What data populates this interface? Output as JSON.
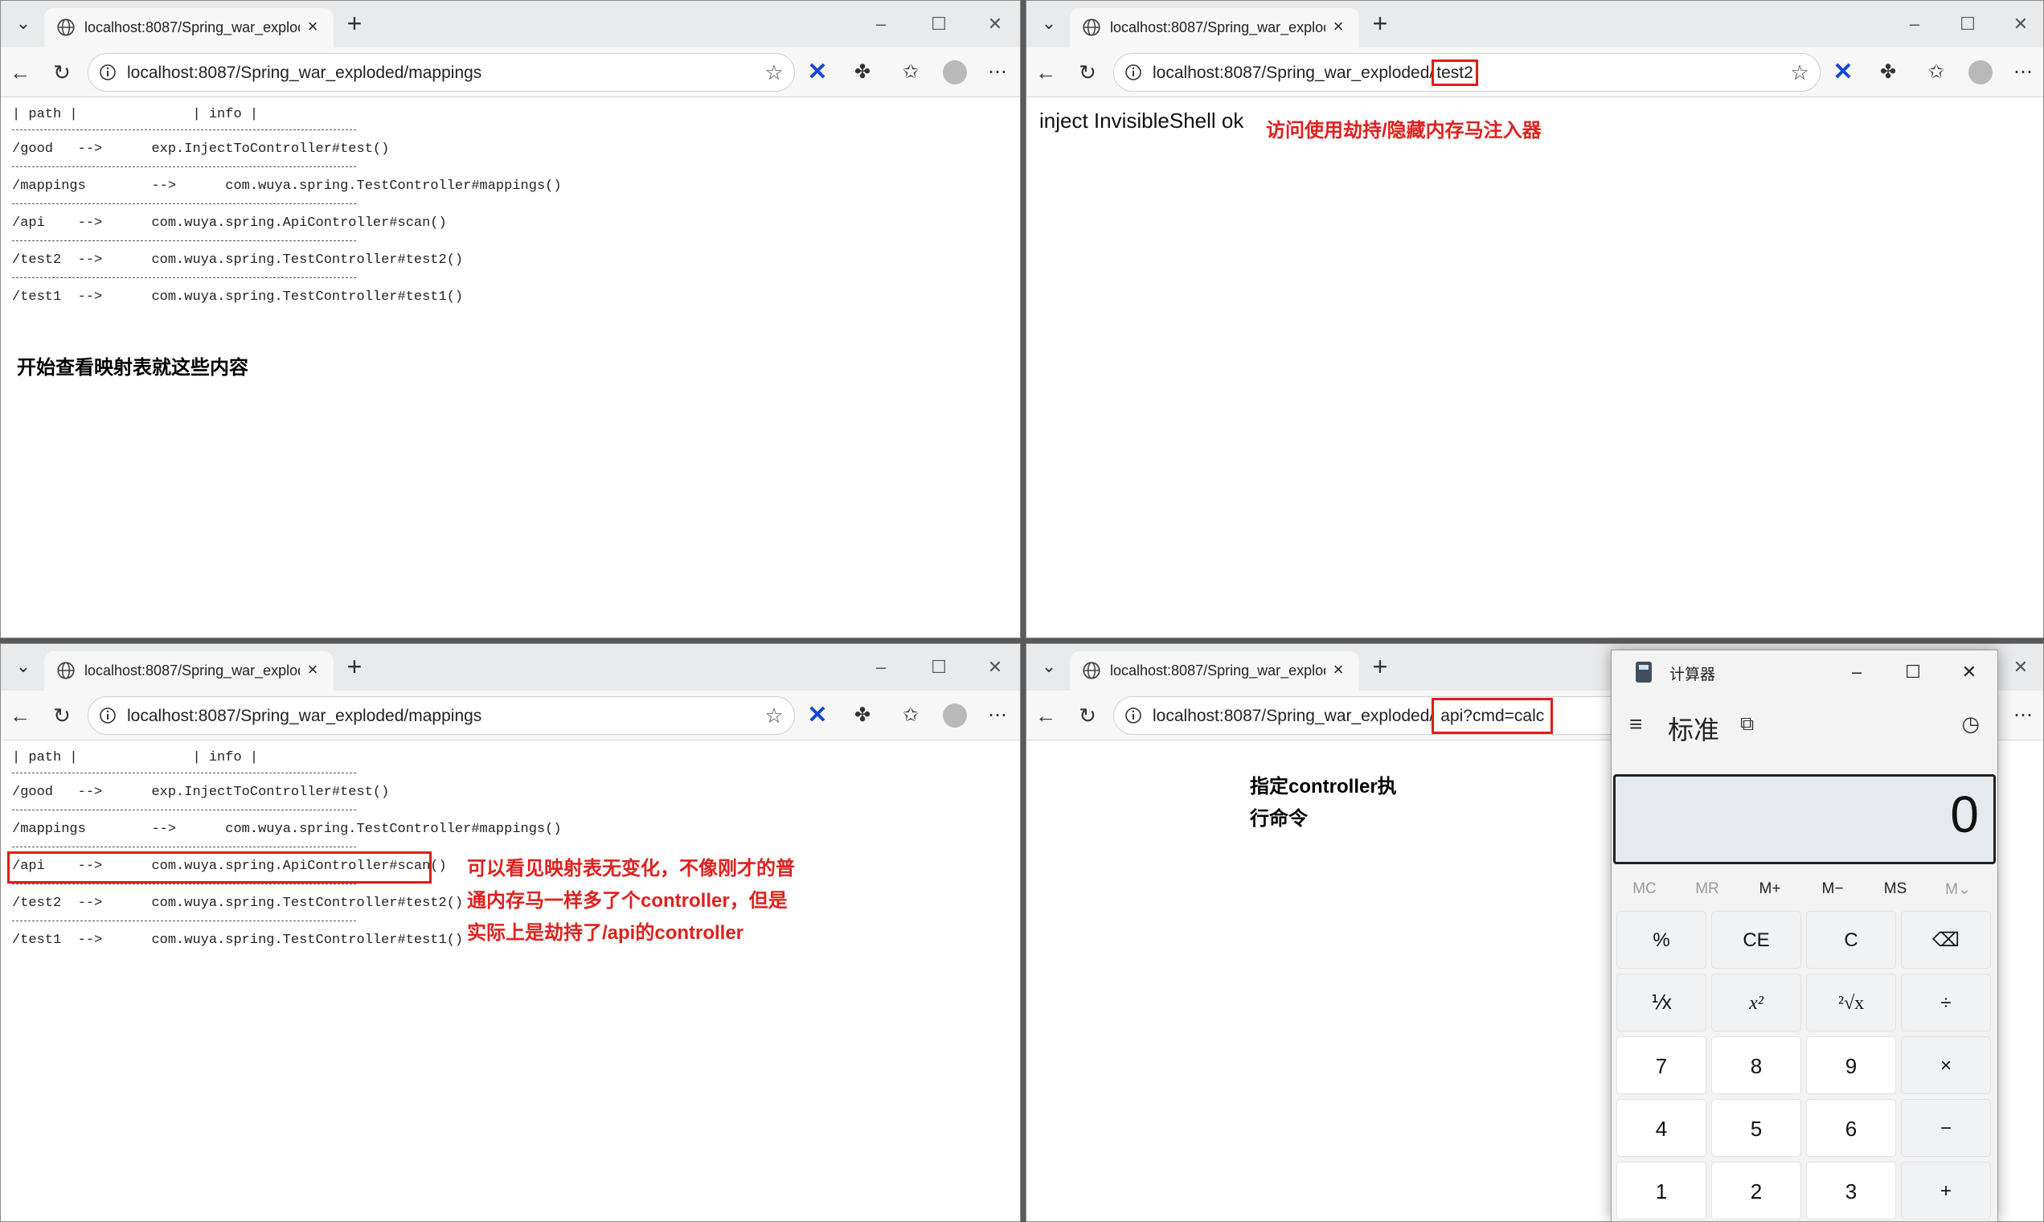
{
  "windows": {
    "top_left": {
      "tab_title": "localhost:8087/Spring_war_exploded/mappings",
      "url": "localhost:8087/Spring_war_exploded/mappings"
    },
    "top_right": {
      "tab_title": "localhost:8087/Spring_war_exploded/test2",
      "url_base": "localhost:8087/Spring_war_exploded/",
      "url_path": "test2",
      "body_text": "inject InvisibleShell ok",
      "annotation": "访问使用劫持/隐藏内存马注入器"
    },
    "bottom_left": {
      "tab_title": "localhost:8087/Spring_war_exploded/mappings",
      "url": "localhost:8087/Spring_war_exploded/mappings",
      "annotation_lines": [
        "可以看见映射表无变化，不像刚才的普",
        "通内存马一样多了个controller，但是",
        "实际上是劫持了/api的controller"
      ]
    },
    "bottom_right": {
      "tab_title": "localhost:8087/Spring_war_exploded/api?cmd=calc",
      "url_base": "localhost:8087/Spring_war_exploded/",
      "url_path": "api?cmd=calc",
      "annotation_lines": [
        "指定controller执",
        "行命令"
      ]
    }
  },
  "mappings": {
    "header_path": "path",
    "header_info": "info",
    "rows": [
      {
        "path": "/good",
        "arrow": "-->",
        "info": "exp.InjectToController#test()"
      },
      {
        "path": "/mappings",
        "arrow": "-->",
        "info": "com.wuya.spring.TestController#mappings()"
      },
      {
        "path": "/api",
        "arrow": "-->",
        "info": "com.wuya.spring.ApiController#scan()"
      },
      {
        "path": "/test2",
        "arrow": "-->",
        "info": "com.wuya.spring.TestController#test2()"
      },
      {
        "path": "/test1",
        "arrow": "-->",
        "info": "com.wuya.spring.TestController#test1()"
      }
    ]
  },
  "top_left_annotation": "开始查看映射表就这些内容",
  "calculator": {
    "title": "计算器",
    "mode": "标准",
    "display": "0",
    "memory": [
      "MC",
      "MR",
      "M+",
      "M−",
      "MS",
      "M⌄"
    ],
    "keys": [
      [
        "%",
        "CE",
        "C",
        "⌫"
      ],
      [
        "⅟x",
        "x²",
        "²√x",
        "÷"
      ],
      [
        "7",
        "8",
        "9",
        "×"
      ],
      [
        "4",
        "5",
        "6",
        "−"
      ],
      [
        "1",
        "2",
        "3",
        "+"
      ]
    ]
  }
}
